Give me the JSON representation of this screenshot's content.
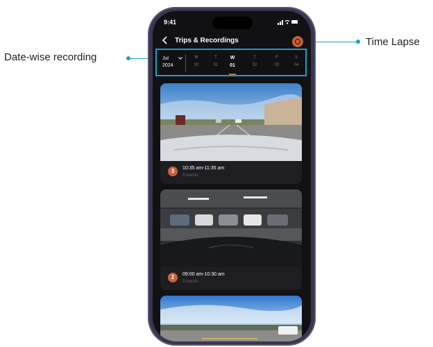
{
  "annotations": {
    "date_wise": "Date-wise recording",
    "time_lapse": "Time Lapse"
  },
  "status_bar": {
    "time": "9:41",
    "icons": "signal wifi battery"
  },
  "header": {
    "back_icon": "chevron-left-icon",
    "title": "Trips & Recordings",
    "time_lapse_icon": "time-lapse-icon"
  },
  "date_strip": {
    "month": "Jul",
    "year": "2024",
    "days": [
      {
        "dow": "M",
        "date": "30",
        "selected": false
      },
      {
        "dow": "T",
        "date": "31",
        "selected": false
      },
      {
        "dow": "W",
        "date": "01",
        "selected": true
      },
      {
        "dow": "T",
        "date": "02",
        "selected": false
      },
      {
        "dow": "F",
        "date": "03",
        "selected": false
      },
      {
        "dow": "S",
        "date": "04",
        "selected": false
      }
    ]
  },
  "recordings": [
    {
      "index": "3",
      "time_range": "10:35 am-11:35 am",
      "events": "5 events",
      "scene": "highway"
    },
    {
      "index": "2",
      "time_range": "09:00 am-10:30 am",
      "events": "0 events",
      "scene": "parking-garage"
    },
    {
      "index": "",
      "time_range": "",
      "events": "",
      "scene": "open-road"
    }
  ],
  "colors": {
    "accent": "#c9613a",
    "highlight": "#1aa0c8",
    "screen_bg": "#111114",
    "card_bg": "#1e1e21"
  }
}
